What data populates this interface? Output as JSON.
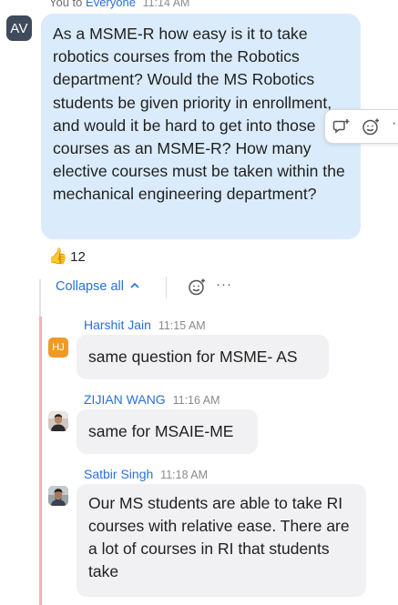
{
  "main_message": {
    "meta_prefix": "You to",
    "recipient": "Everyone",
    "time": "11:14 AM",
    "avatar_initials": "AV",
    "text": "As a MSME-R how easy is it to take robotics courses from the Robotics department? Would the MS Robotics students be given priority in enrollment, and would it be hard to get into those courses as an MSME-R? How many elective courses must be taken within the mechanical engineering department?"
  },
  "hover_actions": {
    "icons": [
      "reply-in-thread-icon",
      "add-reaction-icon",
      "more-options-icon"
    ]
  },
  "reaction": {
    "emoji": "👍",
    "count": "12"
  },
  "thread": {
    "collapse_label": "Collapse all",
    "replies": [
      {
        "name": "Harshit Jain",
        "time": "11:15 AM",
        "avatar_initials": "HJ",
        "avatar_color": "#ee9a24",
        "text": "same question for MSME- AS"
      },
      {
        "name": "ZIJIAN WANG",
        "time": "11:16 AM",
        "text": "same for MSAIE-ME"
      },
      {
        "name": "Satbir Singh",
        "time": "11:18 AM",
        "text": "Our MS students are able to take RI courses with relative ease. There are a lot of courses in RI that students take"
      }
    ]
  },
  "colors": {
    "main_bubble": "#daebfb",
    "reply_bubble": "#f1f1f3",
    "link": "#2a6fdb",
    "thread_accent": "#f0b4b4"
  }
}
